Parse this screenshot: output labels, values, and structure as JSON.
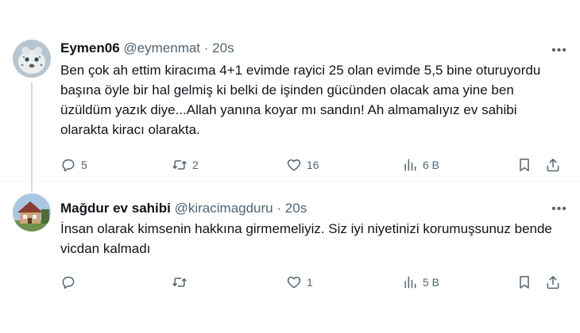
{
  "tweets": [
    {
      "name": "Eymen06",
      "handle": "@eymenmat",
      "separator": "·",
      "time": "20s",
      "text": "Ben çok ah ettim kiracıma 4+1 evimde rayici 25 olan evimde 5,5 bine oturuyordu başına öyle bir hal gelmiş ki belki de işinden gücünden olacak ama yine ben üzüldüm yazık diye...Allah yanına koyar mı sandın! Ah almamalıyız ev sahibi olarakta kiracı olarakta.",
      "replies": "5",
      "retweets": "2",
      "likes": "16",
      "views": "6 B"
    },
    {
      "name": "Mağdur ev sahibi",
      "handle": "@kiracimagduru",
      "separator": "·",
      "time": "20s",
      "text": "İnsan olarak kimsenin hakkına girmemeliyiz. Siz iyi niyetinizi korumuşsunuz bende vicdan kalmadı",
      "replies": "",
      "retweets": "",
      "likes": "1",
      "views": "5 B"
    }
  ],
  "icons": {
    "reply": "reply-icon",
    "retweet": "retweet-icon",
    "like": "heart-icon",
    "views": "views-icon",
    "bookmark": "bookmark-icon",
    "share": "share-icon",
    "more": "more-icon"
  },
  "colors": {
    "text": "#0f1419",
    "muted": "#536471",
    "thread_line": "#cfd9de"
  }
}
